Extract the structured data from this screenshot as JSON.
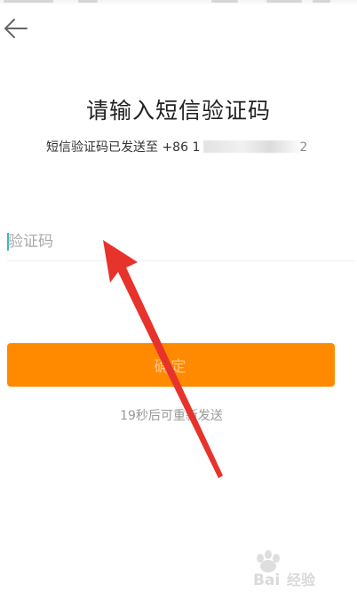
{
  "header": {
    "back_icon": "arrow-left-icon"
  },
  "verify": {
    "title": "请输入短信验证码",
    "sent_prefix": "短信验证码已发送至",
    "phone_visible": "+86 1",
    "phone_suffix": "2",
    "input_placeholder": "验证码",
    "input_value": "",
    "confirm_label": "确定",
    "resend_text": "19秒后可重新发送",
    "countdown_seconds": 19
  },
  "colors": {
    "accent": "#ff8a00",
    "annotation_arrow": "#e8322c",
    "caret": "#43b5c8"
  },
  "overlay": {
    "annotation": "red-arrow-icon",
    "watermark_logo": "Bai经验"
  }
}
